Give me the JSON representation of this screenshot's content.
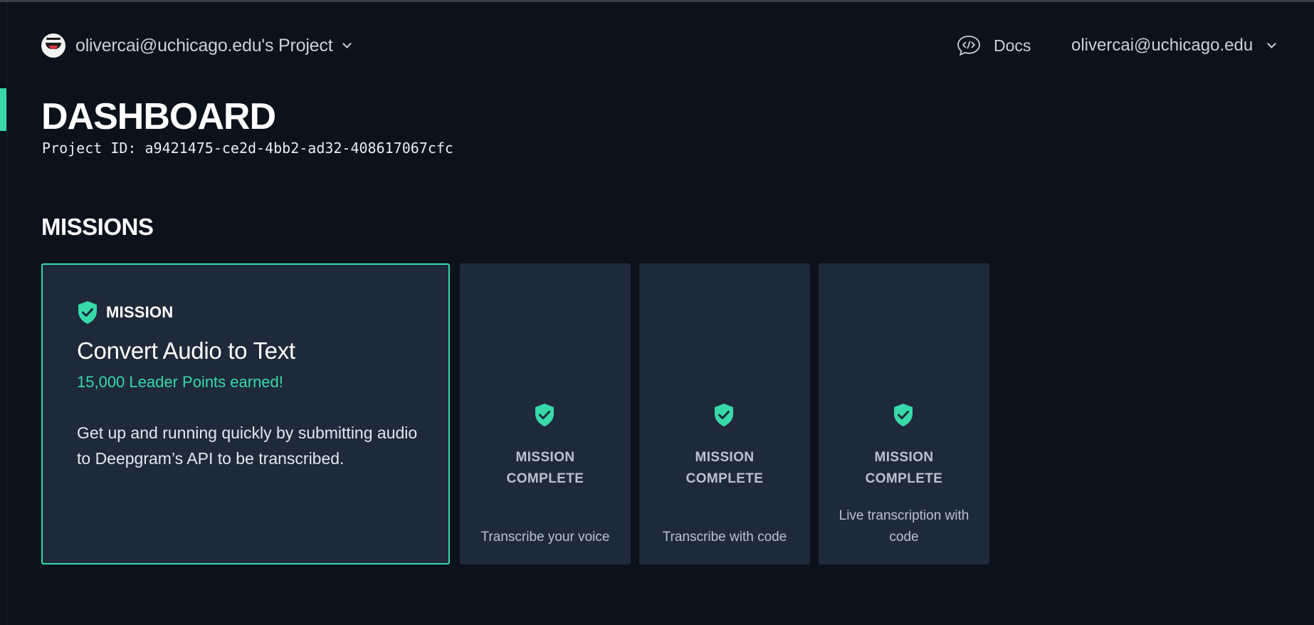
{
  "header": {
    "project_name": "olivercai@uchicago.edu's Project",
    "docs_label": "Docs",
    "user_email": "olivercai@uchicago.edu"
  },
  "dashboard": {
    "title": "DASHBOARD",
    "project_id": "Project ID: a9421475-ce2d-4bb2-ad32-408617067cfc"
  },
  "missions": {
    "section_title": "MISSIONS",
    "featured": {
      "tag": "MISSION",
      "title": "Convert Audio to Text",
      "points": "15,000 Leader Points earned!",
      "description": "Get up and running quickly by submitting audio to Deepgram’s API to be transcribed."
    },
    "cards": [
      {
        "status_line1": "MISSION",
        "status_line2": "COMPLETE",
        "caption": "Transcribe your voice"
      },
      {
        "status_line1": "MISSION",
        "status_line2": "COMPLETE",
        "caption": "Transcribe with code"
      },
      {
        "status_line1": "MISSION",
        "status_line2": "COMPLETE",
        "caption": "Live transcription with code"
      }
    ]
  },
  "colors": {
    "background": "#0b121c",
    "card": "#1e2a3a",
    "accent": "#38d9a9"
  },
  "icons": [
    "avatar",
    "chevron-down-icon",
    "docs-chat-code-icon",
    "shield-check-icon"
  ]
}
